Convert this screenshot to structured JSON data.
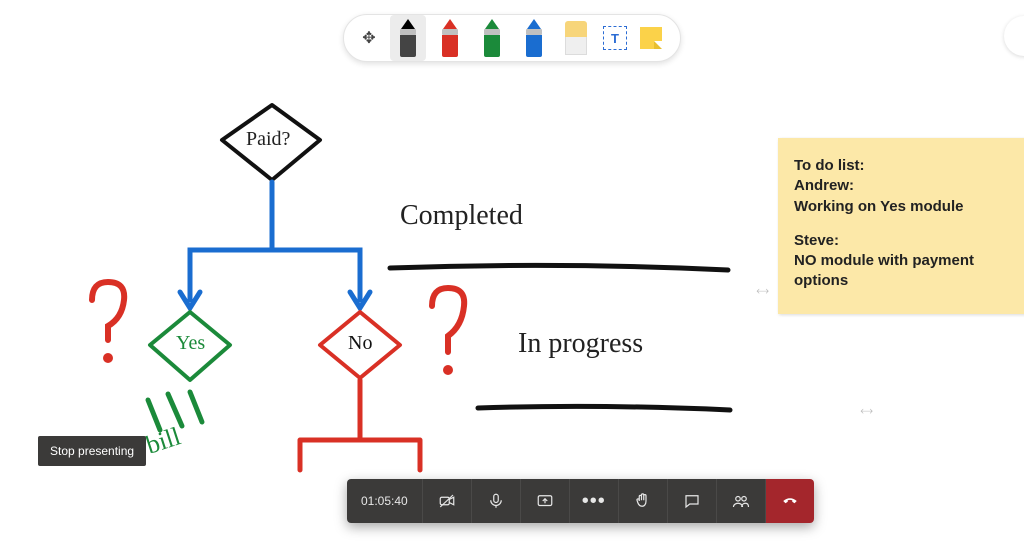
{
  "toolbar": {
    "tools": {
      "move": {
        "name": "move-tool"
      },
      "penBlack": {
        "name": "pen-black",
        "color": "#444",
        "selected": true
      },
      "penRed": {
        "name": "pen-red",
        "color": "#d93025"
      },
      "penGreen": {
        "name": "pen-green",
        "color": "#1b8a3a"
      },
      "penBlue": {
        "name": "pen-blue",
        "color": "#1a6dd0"
      },
      "eraser": {
        "name": "eraser-tool"
      },
      "text": {
        "name": "text-tool",
        "glyph": "T"
      },
      "note": {
        "name": "sticky-note-tool"
      }
    }
  },
  "flowchart": {
    "decision_label": "Paid?",
    "yes_label": "Yes",
    "no_label": "No",
    "bill_label": "bill"
  },
  "status": {
    "completed": "Completed",
    "in_progress": "In progress"
  },
  "sticky": {
    "title": "To do list:",
    "andrew_name": "Andrew:",
    "andrew_task": "Working on Yes module",
    "steve_name": "Steve:",
    "steve_task": "NO module with payment options"
  },
  "tooltip": {
    "stop_presenting": "Stop presenting"
  },
  "meeting": {
    "timer": "01:05:40",
    "buttons": [
      "camera",
      "mic",
      "share",
      "more",
      "raise-hand",
      "chat",
      "people",
      "hangup"
    ]
  }
}
